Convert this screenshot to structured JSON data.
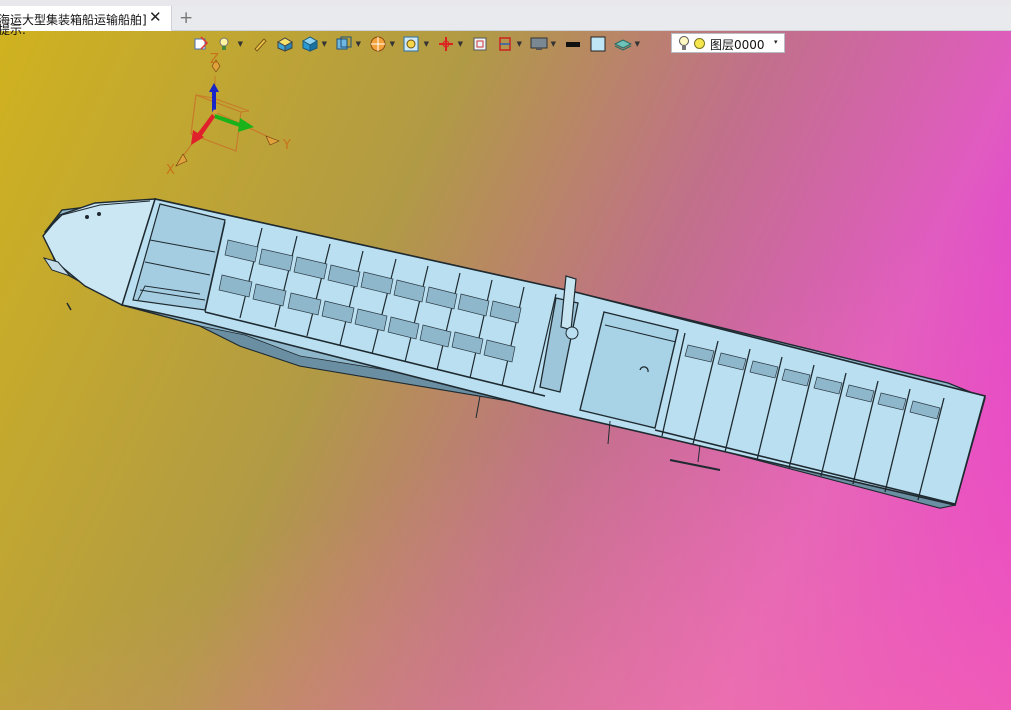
{
  "tabs": [
    {
      "title": "海运大型集装箱船运输船舶]",
      "close_glyph": "✕",
      "active": true
    }
  ],
  "new_tab_glyph": "+",
  "viewport": {
    "hint_text": "提示.",
    "background_colors": [
      "#e41fe2",
      "#b19a45",
      "#d0b21f",
      "#f98c96"
    ]
  },
  "toolbar": {
    "icons": [
      "import-icon",
      "light-icon",
      "pen-icon",
      "box-solid-icon",
      "cube-icon",
      "view-cube-icon",
      "render-sphere-icon",
      "zoom-fit-icon",
      "move-icon",
      "frame-icon",
      "section-icon",
      "display-icon",
      "line-color-icon",
      "fill-color-icon",
      "layer-stack-icon"
    ],
    "layer_selector": {
      "value": "图层0000",
      "dropdown_glyph": "▾"
    }
  },
  "triad": {
    "x_label": "X",
    "y_label": "Y",
    "z_label": "Z"
  },
  "colors": {
    "hull_light": "#b9dff1",
    "hull_mid": "#8fb7cc",
    "hull_dark": "#6b8fa2",
    "edge": "#1f2a30",
    "axis_x": "#e0202a",
    "axis_y": "#1ab21a",
    "axis_z": "#1826c8"
  }
}
